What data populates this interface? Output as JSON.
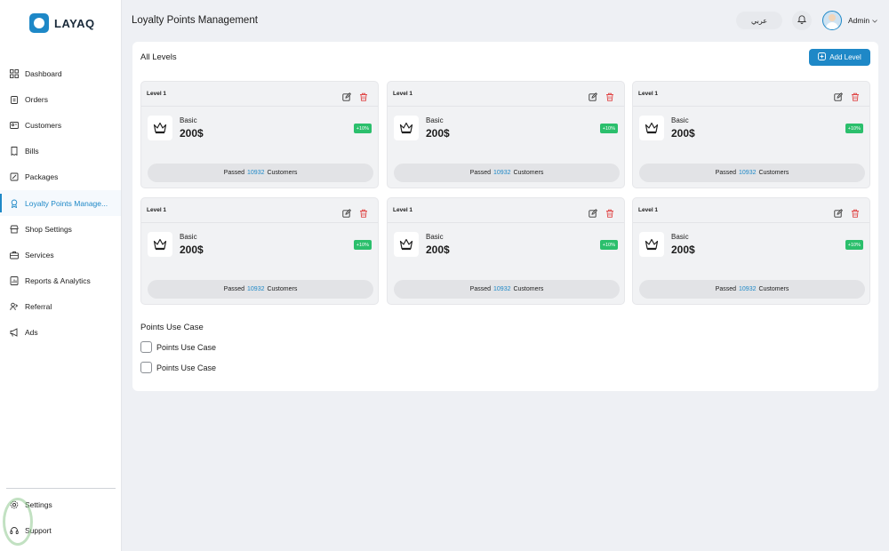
{
  "brand": {
    "name": "LAYAQ"
  },
  "sidebar": {
    "items": [
      {
        "label": "Dashboard",
        "icon": "grid-icon"
      },
      {
        "label": "Orders",
        "icon": "clipboard-icon"
      },
      {
        "label": "Customers",
        "icon": "id-card-icon"
      },
      {
        "label": "Bills",
        "icon": "receipt-icon"
      },
      {
        "label": "Packages",
        "icon": "package-icon"
      },
      {
        "label": "Loyalty Points Manage...",
        "icon": "award-icon",
        "active": true
      },
      {
        "label": "Shop Settings",
        "icon": "store-icon"
      },
      {
        "label": "Services",
        "icon": "briefcase-icon"
      },
      {
        "label": "Reports & Analytics",
        "icon": "report-icon"
      },
      {
        "label": "Referral",
        "icon": "referral-icon"
      },
      {
        "label": "Ads",
        "icon": "megaphone-icon"
      }
    ],
    "bottom": [
      {
        "label": "Settings",
        "icon": "gear-icon"
      },
      {
        "label": "Support",
        "icon": "headset-icon"
      }
    ]
  },
  "header": {
    "title": "Loyalty Points Management",
    "language": "عربي",
    "user": "Admin"
  },
  "levels": {
    "title": "All Levels",
    "add_label": "Add Level",
    "cards": [
      {
        "level": "Level 1",
        "tier": "Basic",
        "price": "200$",
        "bonus": "+10%",
        "passed_prefix": "Passed",
        "count": "10932",
        "passed_suffix": "Customers"
      },
      {
        "level": "Level 1",
        "tier": "Basic",
        "price": "200$",
        "bonus": "+10%",
        "passed_prefix": "Passed",
        "count": "10932",
        "passed_suffix": "Customers"
      },
      {
        "level": "Level 1",
        "tier": "Basic",
        "price": "200$",
        "bonus": "+10%",
        "passed_prefix": "Passed",
        "count": "10932",
        "passed_suffix": "Customers"
      },
      {
        "level": "Level 1",
        "tier": "Basic",
        "price": "200$",
        "bonus": "+10%",
        "passed_prefix": "Passed",
        "count": "10932",
        "passed_suffix": "Customers"
      },
      {
        "level": "Level 1",
        "tier": "Basic",
        "price": "200$",
        "bonus": "+10%",
        "passed_prefix": "Passed",
        "count": "10932",
        "passed_suffix": "Customers"
      },
      {
        "level": "Level 1",
        "tier": "Basic",
        "price": "200$",
        "bonus": "+10%",
        "passed_prefix": "Passed",
        "count": "10932",
        "passed_suffix": "Customers"
      }
    ]
  },
  "use_cases": {
    "title": "Points Use Case",
    "options": [
      {
        "label": "Points Use Case",
        "checked": false
      },
      {
        "label": "Points Use Case",
        "checked": false
      }
    ]
  },
  "colors": {
    "accent": "#1e88c7",
    "badge": "#2bbf6c",
    "delete": "#e04848"
  }
}
